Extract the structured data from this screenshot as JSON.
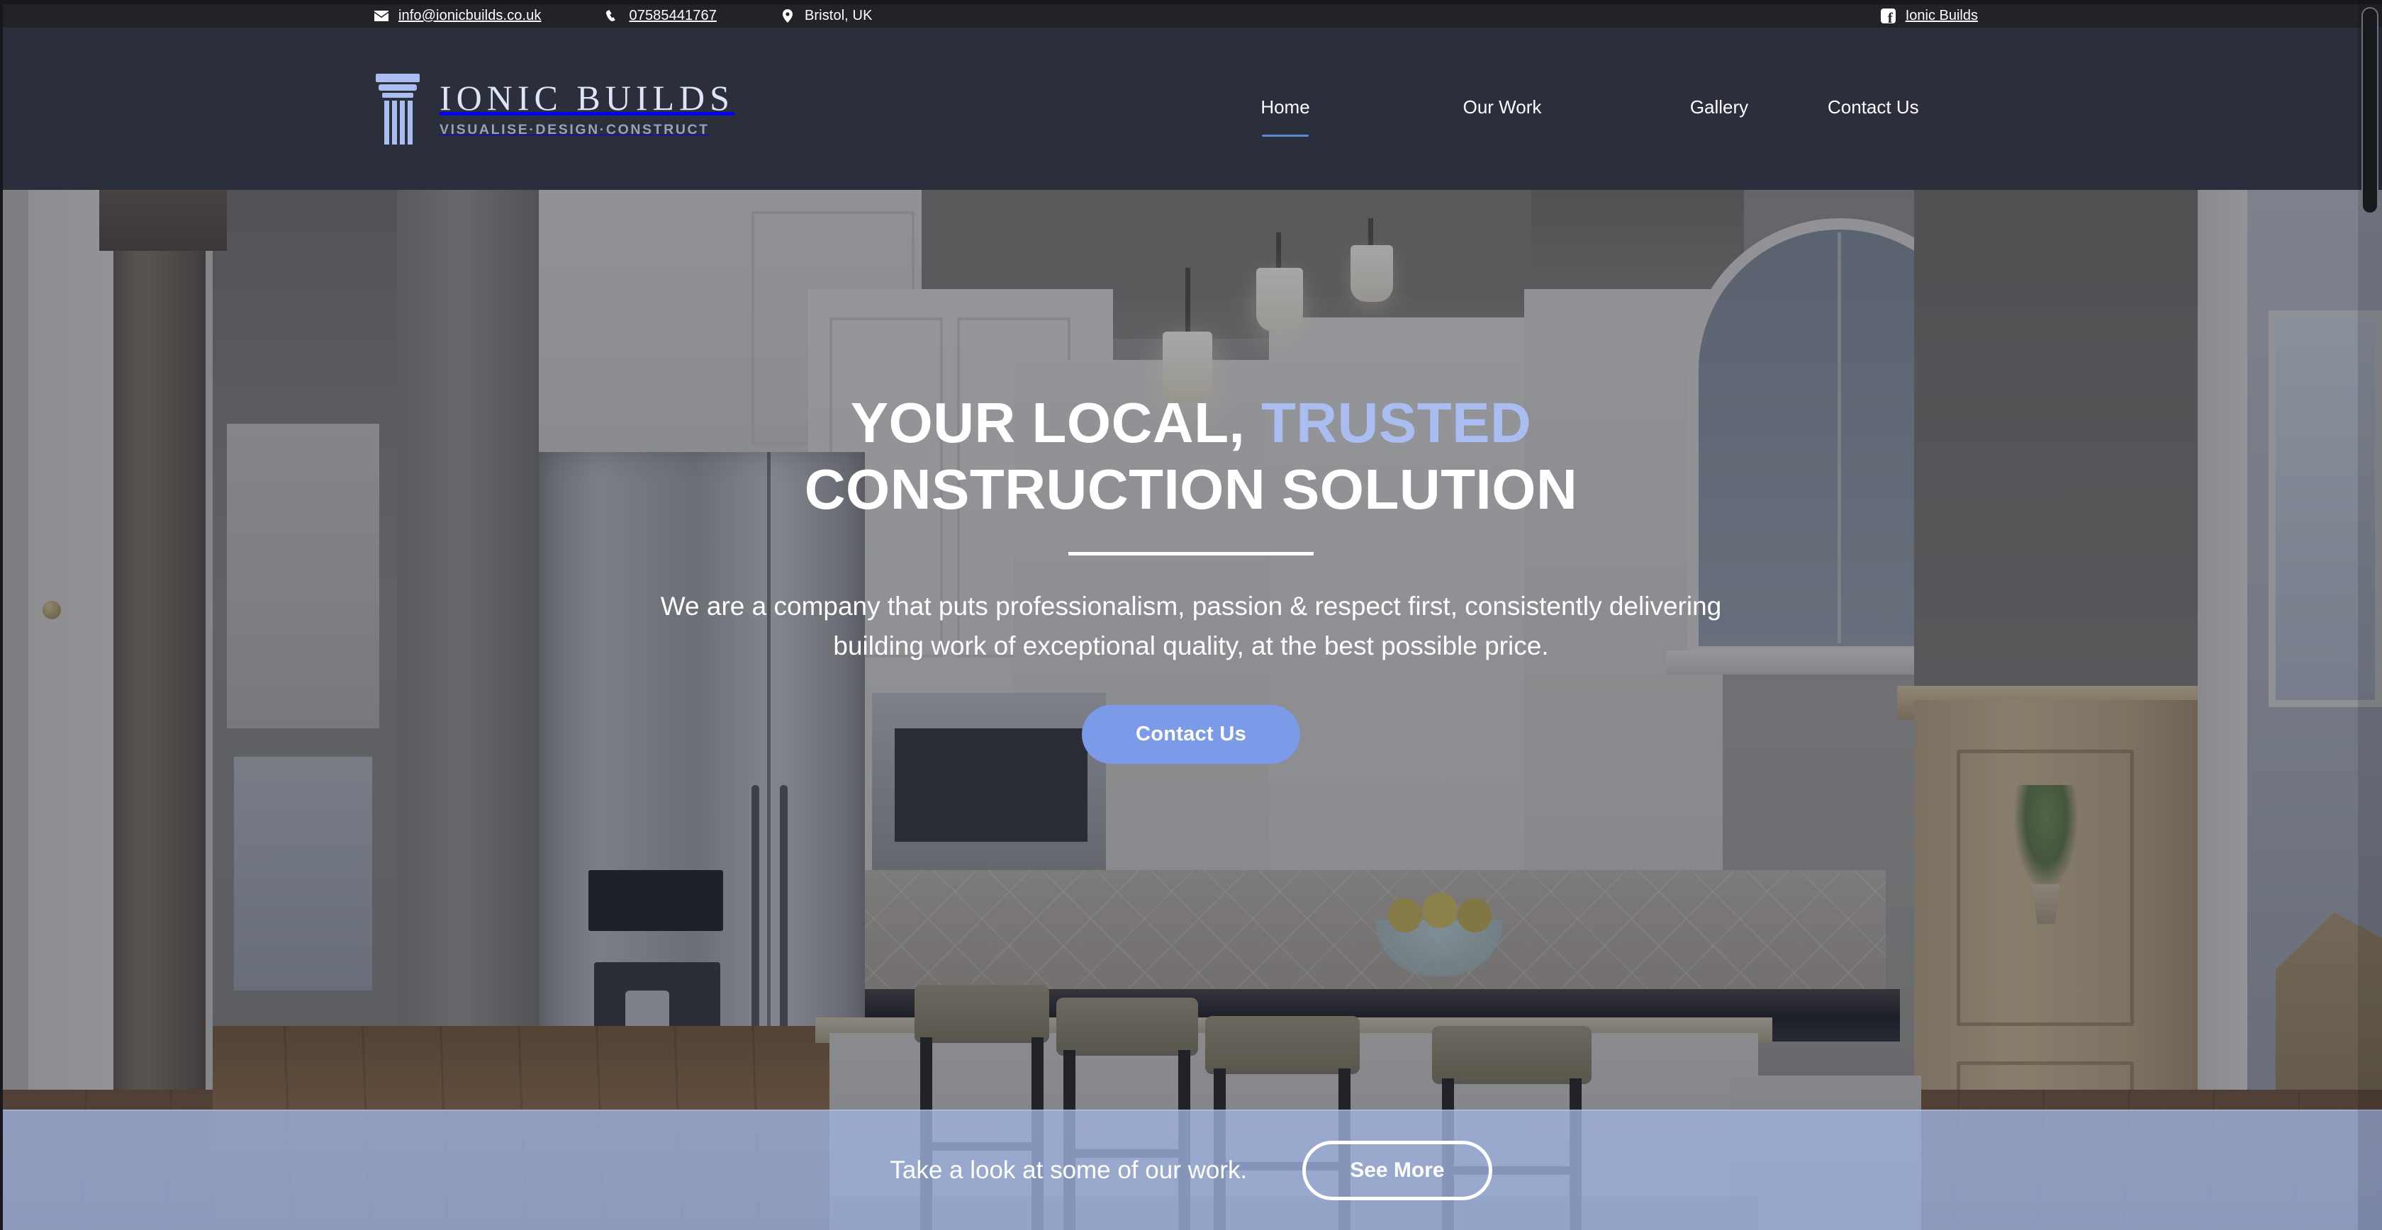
{
  "topbar": {
    "email": "info@ionicbuilds.co.uk",
    "email_icon": "envelope-icon",
    "phone": "07585441767",
    "phone_icon": "phone-icon",
    "location": "Bristol, UK",
    "location_icon": "map-pin-icon",
    "social_label": "Ionic Builds",
    "social_icon": "facebook-icon"
  },
  "brand": {
    "name": "IONIC BUILDS",
    "tagline": "VISUALISE·DESIGN·CONSTRUCT",
    "logo_icon": "ionic-column-icon",
    "logo_color": "#a9bdf0"
  },
  "nav": {
    "items": [
      {
        "label": "Home",
        "active": true
      },
      {
        "label": "Our Work",
        "active": false
      },
      {
        "label": "Gallery",
        "active": false
      },
      {
        "label": "Contact Us",
        "active": false
      }
    ],
    "active_underline_color": "#5b87d8"
  },
  "hero": {
    "heading_line1_part1": "YOUR LOCAL, ",
    "heading_line1_accent": "TRUSTED",
    "heading_line2": "CONSTRUCTION SOLUTION",
    "accent_color": "#a9bdf0",
    "subheading": "We are a company that puts professionalism, passion & respect first, consistently delivering building work of exceptional quality, at the best possible price.",
    "cta_label": "Contact Us",
    "cta_color": "#7b9ae8",
    "background_image": "kitchen-interior-photo"
  },
  "banner": {
    "text": "Take a look at some of our work.",
    "button_label": "See More",
    "background_color": "#9fb2de"
  },
  "chrome": {
    "navbar_color": "#2b2e3b",
    "topbar_color": "#212329",
    "scrollbar": "vertical-scrollbar"
  }
}
